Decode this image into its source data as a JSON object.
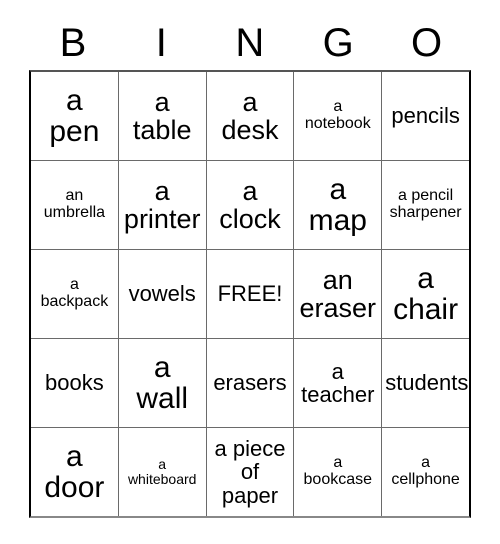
{
  "card": {
    "title_letters": [
      "B",
      "I",
      "N",
      "G",
      "O"
    ],
    "rows": [
      [
        {
          "text": "a\npen",
          "size": "xl"
        },
        {
          "text": "a\ntable",
          "size": "lg"
        },
        {
          "text": "a\ndesk",
          "size": "lg"
        },
        {
          "text": "a\nnotebook",
          "size": "sm"
        },
        {
          "text": "pencils",
          "size": "md"
        }
      ],
      [
        {
          "text": "an\numbrella",
          "size": "sm"
        },
        {
          "text": "a\nprinter",
          "size": "lg"
        },
        {
          "text": "a\nclock",
          "size": "lg"
        },
        {
          "text": "a\nmap",
          "size": "xl"
        },
        {
          "text": "a pencil\nsharpener",
          "size": "sm"
        }
      ],
      [
        {
          "text": "a\nbackpack",
          "size": "sm"
        },
        {
          "text": "vowels",
          "size": "md"
        },
        {
          "text": "FREE!",
          "size": "md"
        },
        {
          "text": "an\neraser",
          "size": "lg"
        },
        {
          "text": "a\nchair",
          "size": "xl"
        }
      ],
      [
        {
          "text": "books",
          "size": "md"
        },
        {
          "text": "a\nwall",
          "size": "xl"
        },
        {
          "text": "erasers",
          "size": "md"
        },
        {
          "text": "a\nteacher",
          "size": "md"
        },
        {
          "text": "students",
          "size": "md"
        }
      ],
      [
        {
          "text": "a\ndoor",
          "size": "xl"
        },
        {
          "text": "a\nwhiteboard",
          "size": "xs"
        },
        {
          "text": "a piece\nof\npaper",
          "size": "md"
        },
        {
          "text": "a\nbookcase",
          "size": "sm"
        },
        {
          "text": "a\ncellphone",
          "size": "sm"
        }
      ]
    ]
  },
  "colors": {
    "text": "#000000",
    "grid_line": "#6a6a6a",
    "background": "#ffffff"
  }
}
